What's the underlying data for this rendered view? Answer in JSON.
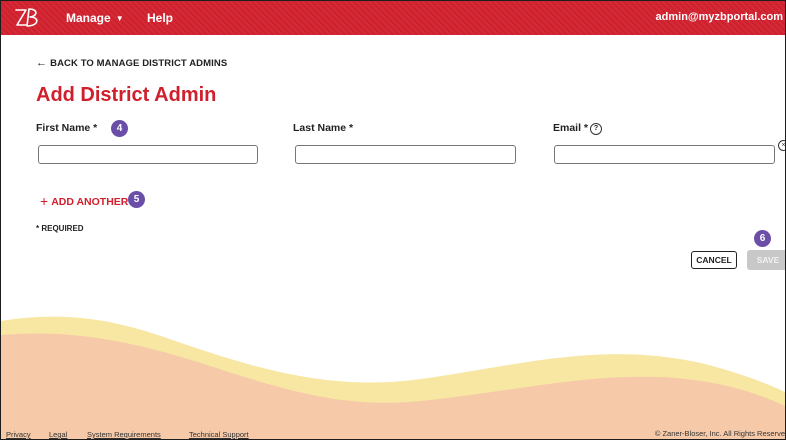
{
  "header": {
    "logo_text": "ZB",
    "nav": {
      "manage": "Manage",
      "help": "Help"
    },
    "user_email": "admin@myzbportal.com"
  },
  "back_link": "BACK TO MANAGE DISTRICT ADMINS",
  "page_title": "Add District Admin",
  "form": {
    "first_name": {
      "label": "First Name *",
      "value": "",
      "placeholder": ""
    },
    "last_name": {
      "label": "Last Name *",
      "value": "",
      "placeholder": ""
    },
    "email": {
      "label": "Email *",
      "value": "",
      "placeholder": ""
    },
    "add_another": "ADD ANOTHER",
    "required_note": "* REQUIRED",
    "cancel_label": "CANCEL",
    "save_label": "SAVE"
  },
  "callouts": {
    "first_name": "4",
    "add_another": "5",
    "save": "6"
  },
  "footer": {
    "links": [
      "Privacy",
      "Legal",
      "System Requirements",
      "Technical Support"
    ],
    "copyright": "© Zaner-Bloser, Inc. All Rights Reserve"
  },
  "colors": {
    "brand_red": "#d0202d",
    "callout_purple": "#6b4ea8",
    "wave_yellow": "#f7e7a3",
    "wave_peach": "#f6c9a8",
    "disabled_gray": "#c8c8c8"
  },
  "icons": [
    "zb-logo",
    "chevron-down-icon",
    "arrow-left-icon",
    "help-circle-icon",
    "clear-circle-icon",
    "plus-icon"
  ]
}
